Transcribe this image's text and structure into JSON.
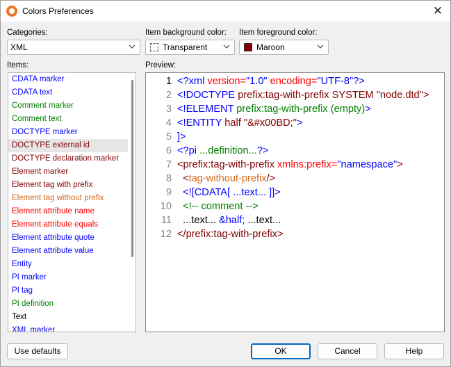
{
  "window": {
    "title": "Colors Preferences"
  },
  "categories": {
    "label": "Categories:",
    "value": "XML"
  },
  "item_background": {
    "label": "Item background color:",
    "value": "Transparent"
  },
  "item_foreground": {
    "label": "Item foreground color:",
    "value": "Maroon",
    "swatch_color": "#800000"
  },
  "items": {
    "label": "Items:",
    "list": [
      {
        "label": "CDATA marker",
        "color": "#0000ff"
      },
      {
        "label": "CDATA text",
        "color": "#0000ff"
      },
      {
        "label": "Comment marker",
        "color": "#008000"
      },
      {
        "label": "Comment text",
        "color": "#008000"
      },
      {
        "label": "DOCTYPE marker",
        "color": "#0000ff"
      },
      {
        "label": "DOCTYPE external id",
        "color": "#800000",
        "selected": true
      },
      {
        "label": "DOCTYPE declaration marker",
        "color": "#800000"
      },
      {
        "label": "Element marker",
        "color": "#800000"
      },
      {
        "label": "Element tag with prefix",
        "color": "#800000"
      },
      {
        "label": "Element tag without prefix",
        "color": "#d2691e"
      },
      {
        "label": "Element attribute name",
        "color": "#ff0000"
      },
      {
        "label": "Element attribute equals",
        "color": "#ff0000"
      },
      {
        "label": "Element attribute quote",
        "color": "#0000ff"
      },
      {
        "label": "Element attribute value",
        "color": "#0000ff"
      },
      {
        "label": "Entity",
        "color": "#0000ff"
      },
      {
        "label": "PI marker",
        "color": "#0000ff"
      },
      {
        "label": "PI tag",
        "color": "#0000ff"
      },
      {
        "label": "PI definition",
        "color": "#008000"
      },
      {
        "label": "Text",
        "color": "#000000"
      },
      {
        "label": "XML marker",
        "color": "#0000ff"
      }
    ]
  },
  "preview": {
    "label": "Preview:",
    "lines": [
      {
        "num": "1",
        "segments": [
          {
            "text": "<?xml ",
            "color": "#0000ff"
          },
          {
            "text": "version",
            "color": "#ff0000"
          },
          {
            "text": "=",
            "color": "#ff0000"
          },
          {
            "text": "\"1.0\" ",
            "color": "#0000ff"
          },
          {
            "text": "encoding",
            "color": "#ff0000"
          },
          {
            "text": "=",
            "color": "#ff0000"
          },
          {
            "text": "\"UTF-8\"",
            "color": "#0000ff"
          },
          {
            "text": "?>",
            "color": "#0000ff"
          }
        ]
      },
      {
        "num": "2",
        "segments": [
          {
            "text": "<!DOCTYPE ",
            "color": "#0000ff"
          },
          {
            "text": "prefix:tag-with-prefix SYSTEM \"node.dtd\">",
            "color": "#800000"
          }
        ]
      },
      {
        "num": "3",
        "segments": [
          {
            "text": "<!ELEMENT ",
            "color": "#0000ff"
          },
          {
            "text": "prefix:tag-with-prefix (empty)",
            "color": "#008000"
          },
          {
            "text": ">",
            "color": "#0000ff"
          }
        ]
      },
      {
        "num": "4",
        "segments": [
          {
            "text": "<!ENTITY ",
            "color": "#0000ff"
          },
          {
            "text": "half \"&#x00BD;\"",
            "color": "#800000"
          },
          {
            "text": ">",
            "color": "#0000ff"
          }
        ]
      },
      {
        "num": "5",
        "segments": [
          {
            "text": "]>",
            "color": "#0000ff"
          }
        ]
      },
      {
        "num": "6",
        "segments": [
          {
            "text": "<?pi ",
            "color": "#0000ff"
          },
          {
            "text": "...definition...",
            "color": "#008000"
          },
          {
            "text": "?>",
            "color": "#0000ff"
          }
        ]
      },
      {
        "num": "7",
        "segments": [
          {
            "text": "<",
            "color": "#800000"
          },
          {
            "text": "prefix:tag-with-prefix ",
            "color": "#800000"
          },
          {
            "text": "xmlns:prefix",
            "color": "#ff0000"
          },
          {
            "text": "=",
            "color": "#ff0000"
          },
          {
            "text": "\"namespace\"",
            "color": "#0000ff"
          },
          {
            "text": ">",
            "color": "#800000"
          }
        ]
      },
      {
        "num": "8",
        "segments": [
          {
            "text": "  ",
            "color": "#000000"
          },
          {
            "text": "<",
            "color": "#800000"
          },
          {
            "text": "tag-without-prefix",
            "color": "#d2691e"
          },
          {
            "text": "/>",
            "color": "#800000"
          }
        ]
      },
      {
        "num": "9",
        "segments": [
          {
            "text": "  ",
            "color": "#000000"
          },
          {
            "text": "<![CDATA[",
            "color": "#0000ff"
          },
          {
            "text": " ...text... ",
            "color": "#0000ff"
          },
          {
            "text": "]]>",
            "color": "#0000ff"
          }
        ]
      },
      {
        "num": "10",
        "segments": [
          {
            "text": "  ",
            "color": "#000000"
          },
          {
            "text": "<!--",
            "color": "#008000"
          },
          {
            "text": " comment ",
            "color": "#008000"
          },
          {
            "text": "-->",
            "color": "#008000"
          }
        ]
      },
      {
        "num": "11",
        "segments": [
          {
            "text": "  ...text... ",
            "color": "#000000"
          },
          {
            "text": "&half;",
            "color": "#0000ff"
          },
          {
            "text": " ...text...",
            "color": "#000000"
          }
        ]
      },
      {
        "num": "12",
        "segments": [
          {
            "text": "</",
            "color": "#800000"
          },
          {
            "text": "prefix:tag-with-prefix",
            "color": "#800000"
          },
          {
            "text": ">",
            "color": "#800000"
          }
        ]
      }
    ]
  },
  "buttons": {
    "use_defaults": "Use defaults",
    "ok": "OK",
    "cancel": "Cancel",
    "help": "Help"
  }
}
